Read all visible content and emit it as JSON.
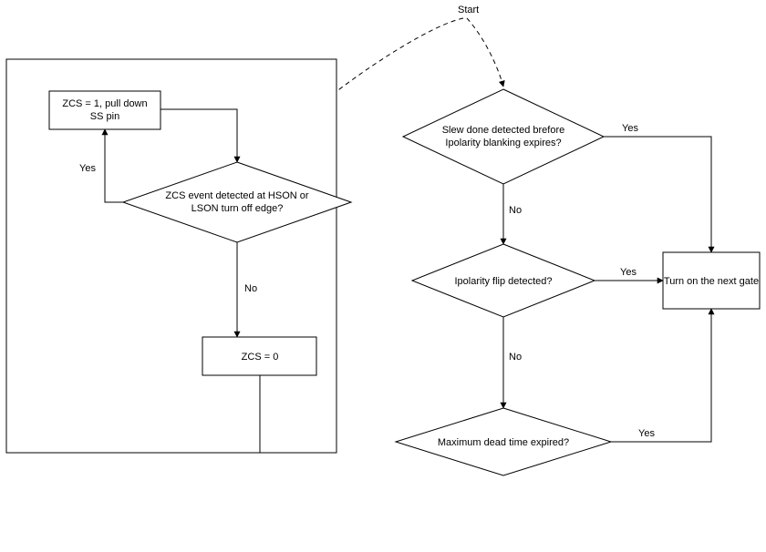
{
  "start_label": "Start",
  "left": {
    "box1_line1": "ZCS = 1, pull down",
    "box1_line2": "SS pin",
    "decision1_line1": "ZCS event detected at HSON or",
    "decision1_line2": "LSON turn off edge?",
    "box2_line1": "ZCS = 0",
    "yes": "Yes",
    "no": "No"
  },
  "right": {
    "d1_line1": "Slew done detected brefore",
    "d1_line2": "Ipolarity blanking expires?",
    "d2_line1": "Ipolarity flip detected?",
    "d3_line1": "Maximum dead time expired?",
    "action_line1": "Turn on the next gate",
    "yes": "Yes",
    "no": "No"
  },
  "chart_data": {
    "type": "flowchart",
    "nodes": [
      {
        "id": "start",
        "type": "start",
        "label": "Start"
      },
      {
        "id": "d_slew",
        "type": "decision",
        "label": "Slew done detected brefore Ipolarity blanking expires?"
      },
      {
        "id": "d_ipol",
        "type": "decision",
        "label": "Ipolarity flip detected?"
      },
      {
        "id": "d_maxdt",
        "type": "decision",
        "label": "Maximum dead time expired?"
      },
      {
        "id": "p_turnon",
        "type": "process",
        "label": "Turn on the next gate"
      },
      {
        "id": "d_zcs",
        "type": "decision",
        "label": "ZCS event detected at HSON or LSON turn off edge?"
      },
      {
        "id": "p_zcs1",
        "type": "process",
        "label": "ZCS = 1, pull down SS pin"
      },
      {
        "id": "p_zcs0",
        "type": "process",
        "label": "ZCS = 0"
      }
    ],
    "edges": [
      {
        "from": "start",
        "to": "d_slew"
      },
      {
        "from": "start",
        "to": "d_zcs",
        "style": "dashed"
      },
      {
        "from": "d_slew",
        "to": "p_turnon",
        "label": "Yes"
      },
      {
        "from": "d_slew",
        "to": "d_ipol",
        "label": "No"
      },
      {
        "from": "d_ipol",
        "to": "p_turnon",
        "label": "Yes"
      },
      {
        "from": "d_ipol",
        "to": "d_maxdt",
        "label": "No"
      },
      {
        "from": "d_maxdt",
        "to": "p_turnon",
        "label": "Yes"
      },
      {
        "from": "d_zcs",
        "to": "p_zcs1",
        "label": "Yes"
      },
      {
        "from": "d_zcs",
        "to": "p_zcs0",
        "label": "No"
      },
      {
        "from": "p_zcs1",
        "to": "d_zcs"
      },
      {
        "from": "p_zcs0",
        "to": "d_zcs",
        "style": "loop"
      }
    ]
  }
}
